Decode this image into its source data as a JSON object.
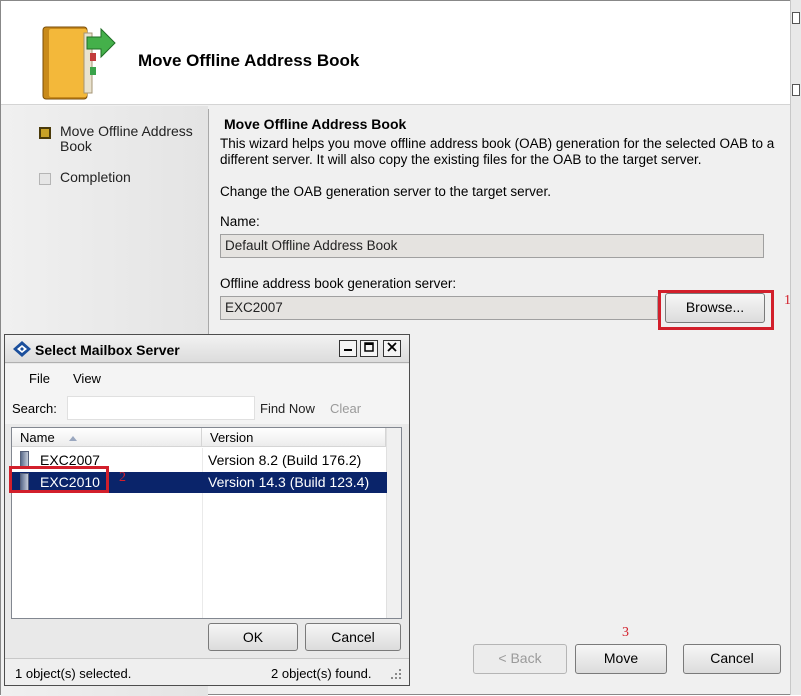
{
  "wizard": {
    "title": "Move Offline Address Book",
    "steps": [
      {
        "label": "Move Offline Address Book",
        "state": "active"
      },
      {
        "label": "Completion",
        "state": "inactive"
      }
    ],
    "page_title": "Move Offline Address Book",
    "description": "This wizard helps you move offline address book (OAB) generation for the selected OAB to a different server. It will also copy the existing files for the OAB to the target server.",
    "instruction": "Change the OAB generation server to the target server.",
    "name_label": "Name:",
    "name_value": "Default Offline Address Book",
    "server_label": "Offline address book generation server:",
    "server_value": "EXC2007",
    "browse_button": "Browse...",
    "back_button": "< Back",
    "move_button": "Move",
    "cancel_button": "Cancel"
  },
  "annotations": {
    "step1": "1",
    "step2": "2",
    "step3": "3",
    "color": "#d21f2b"
  },
  "dialog": {
    "title": "Select Mailbox Server",
    "menu": [
      "File",
      "View"
    ],
    "search_label": "Search:",
    "search_value": "",
    "find_now": "Find Now",
    "clear": "Clear",
    "columns": [
      "Name",
      "Version"
    ],
    "rows": [
      {
        "name": "EXC2007",
        "version": "Version 8.2 (Build 176.2)",
        "selected": false
      },
      {
        "name": "EXC2010",
        "version": "Version 14.3 (Build 123.4)",
        "selected": true
      }
    ],
    "ok_button": "OK",
    "cancel_button": "Cancel",
    "status_selected": "1 object(s) selected.",
    "status_found": "2 object(s) found.",
    "selection_color": "#0a246a"
  }
}
